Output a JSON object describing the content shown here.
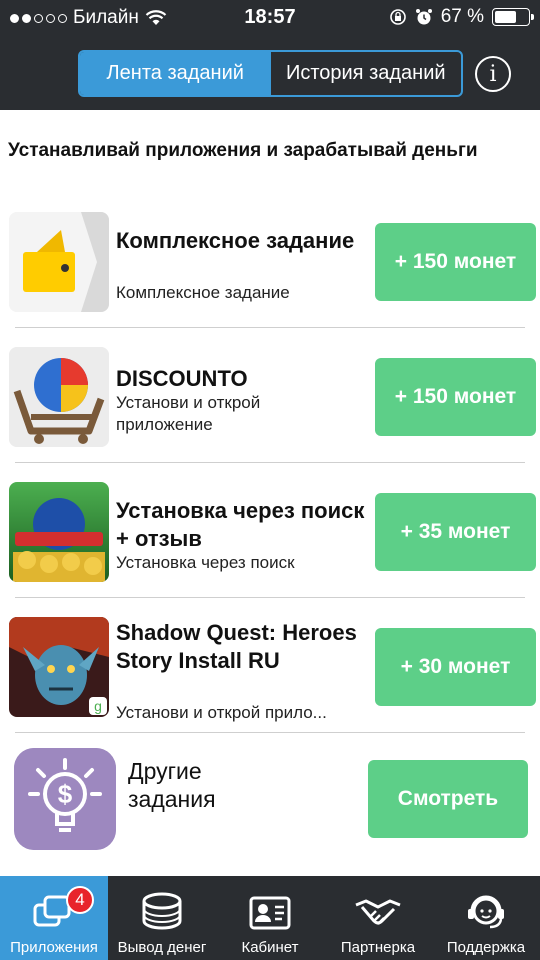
{
  "status_bar": {
    "carrier": "Билайн",
    "time": "18:57",
    "battery_percent": "67 %",
    "battery_level": 0.67,
    "signal_bars": 2
  },
  "header": {
    "tabs": [
      {
        "label": "Лента заданий",
        "active": true
      },
      {
        "label": "История заданий",
        "active": false
      }
    ],
    "info_icon": "info-icon"
  },
  "headline": "Устанавливай приложения и зарабатывай деньги",
  "tasks": [
    {
      "title": "Комплексное задание",
      "subtitle": "Комплексное задание",
      "reward": "+ 150 монет",
      "icon": "wallet-icon"
    },
    {
      "title": "DISCOUNTO",
      "subtitle": "Установи и открой приложение",
      "reward": "+ 150 монет",
      "icon": "cart-icon"
    },
    {
      "title": "Установка через поиск + отзыв",
      "subtitle": "Установка через поиск",
      "reward": "+ 35 монет",
      "icon": "casino-icon"
    },
    {
      "title": "Shadow Quest: Heroes Story Install RU",
      "subtitle": "Установи и открой прило...",
      "reward": "+ 30 монет",
      "icon": "game-hero-icon"
    }
  ],
  "other_tasks": {
    "label": "Другие задания",
    "button": "Смотреть",
    "icon": "lightbulb-dollar-icon"
  },
  "tabbar": [
    {
      "label": "Приложения",
      "icon": "apps-icon",
      "active": true,
      "badge": "4"
    },
    {
      "label": "Вывод денег",
      "icon": "coins-icon",
      "active": false
    },
    {
      "label": "Кабинет",
      "icon": "profile-card-icon",
      "active": false
    },
    {
      "label": "Партнерка",
      "icon": "handshake-icon",
      "active": false
    },
    {
      "label": "Поддержка",
      "icon": "support-icon",
      "active": false
    }
  ],
  "colors": {
    "accent": "#3b9ad8",
    "reward_green": "#5dcf88",
    "dark_bar": "#2a2d31",
    "badge_red": "#e8242b"
  }
}
